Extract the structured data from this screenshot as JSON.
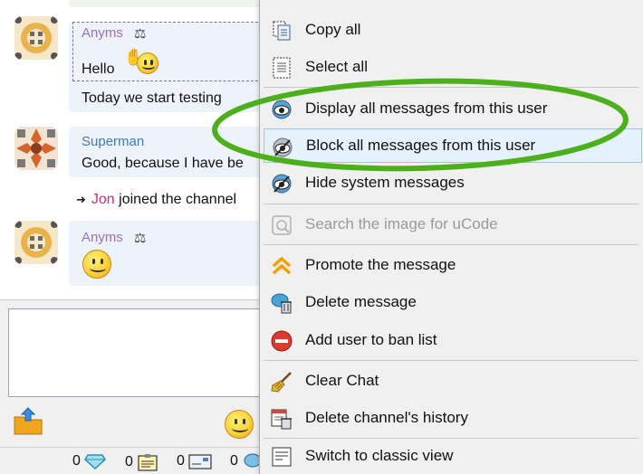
{
  "messages": [
    {
      "nick": "Anyms",
      "text": "Hello",
      "text2": "Today we start testing"
    },
    {
      "nick": "Superman",
      "text": "Good, because I have be"
    },
    {
      "nick": "Anyms"
    }
  ],
  "system_message": {
    "user": "Jon",
    "text": "joined the channel"
  },
  "status_counts": [
    "0",
    "0",
    "0",
    "0"
  ],
  "context_menu": {
    "items": [
      {
        "label": "Copy all",
        "icon": "copy-icon"
      },
      {
        "label": "Select all",
        "icon": "select-all-icon"
      },
      {
        "label": "Display all messages from this user",
        "icon": "eye-icon"
      },
      {
        "label": "Block all messages from this user",
        "icon": "eye-blocked-icon"
      },
      {
        "label": "Hide system messages",
        "icon": "eye-hide-icon"
      },
      {
        "label": "Search the image for uCode",
        "icon": "search-image-icon"
      },
      {
        "label": "Promote the message",
        "icon": "promote-icon"
      },
      {
        "label": "Delete message",
        "icon": "delete-message-icon"
      },
      {
        "label": "Add user to ban list",
        "icon": "ban-icon"
      },
      {
        "label": "Clear Chat",
        "icon": "broom-icon"
      },
      {
        "label": "Delete channel's history",
        "icon": "delete-history-icon"
      },
      {
        "label": "Switch to classic view",
        "icon": "classic-view-icon"
      }
    ]
  },
  "colors": {
    "menu_background": "#f0f0f0",
    "menu_hover": "#e5f1fb",
    "annotation_ellipse": "#4caf1c",
    "nick_purple": "#9a6fb3",
    "nick_blue": "#3f7ab8",
    "system_user": "#c0308c"
  }
}
